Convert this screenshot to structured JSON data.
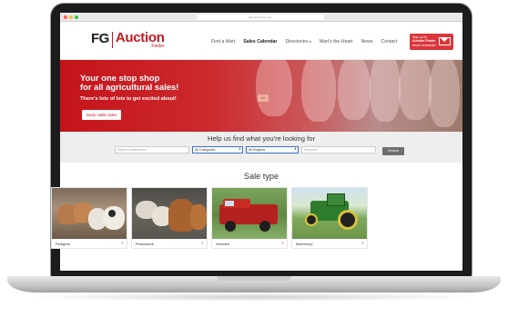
{
  "browser": {
    "url": "fgauctionfinder.com"
  },
  "site": {
    "logo_fg": "FG",
    "logo_word": "Auction",
    "logo_finder": "Finder",
    "nav": [
      {
        "label": "Find a Mart",
        "active": false
      },
      {
        "label": "Sales Calendar",
        "active": true
      },
      {
        "label": "Directories",
        "active": false,
        "dropdown": true
      },
      {
        "label": "Mart's the Heart",
        "active": false
      },
      {
        "label": "News",
        "active": false
      },
      {
        "label": "Contact",
        "active": false
      }
    ],
    "signup_lines": [
      "Sign up to",
      "Auction Finder",
      "email newsletter"
    ]
  },
  "hero": {
    "title_line1": "Your one stop shop",
    "title_line2": "for all agricultural sales!",
    "subtitle": "There's lots of lots to get excited about!",
    "button": "Dairy cattle sales",
    "ear_tag": "117"
  },
  "search": {
    "heading": "Help us find what you're looking for",
    "keyword_placeholder": "Search Auctioneers",
    "category_value": "All Categories",
    "region_value": "All Regions",
    "text_placeholder": "Keyword",
    "button": "Search"
  },
  "sale_type": {
    "heading": "Sale type",
    "cards": [
      {
        "label": "Pedigree"
      },
      {
        "label": "Primestock"
      },
      {
        "label": "Vehicles"
      },
      {
        "label": "Machinery"
      }
    ]
  },
  "colors": {
    "brand_red": "#c7161d",
    "search_button": "#6e6e6e"
  }
}
